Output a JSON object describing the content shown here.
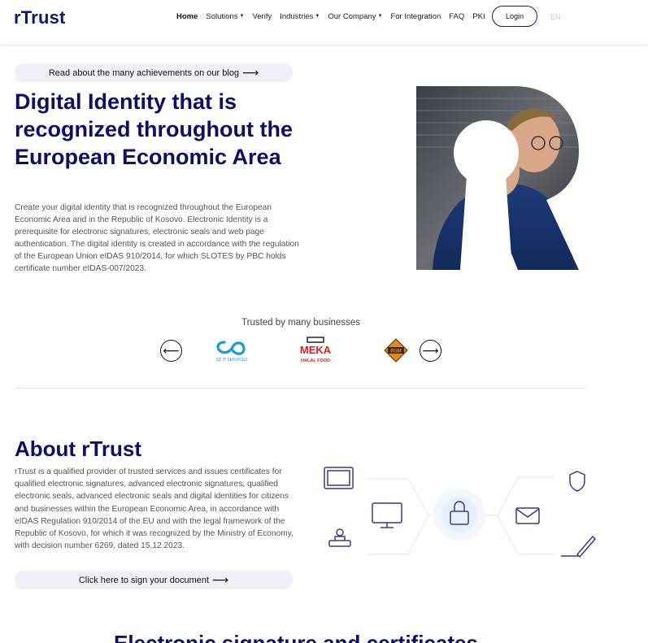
{
  "header": {
    "logo": "rTrust",
    "nav": [
      {
        "label": "Home",
        "active": true,
        "dropdown": false
      },
      {
        "label": "Solutions",
        "active": false,
        "dropdown": true
      },
      {
        "label": "Verify",
        "active": false,
        "dropdown": false
      },
      {
        "label": "Industries",
        "active": false,
        "dropdown": true
      },
      {
        "label": "Our Company",
        "active": false,
        "dropdown": true
      },
      {
        "label": "For Integration",
        "active": false,
        "dropdown": false
      },
      {
        "label": "FAQ",
        "active": false,
        "dropdown": false
      },
      {
        "label": "PKI",
        "active": false,
        "dropdown": false
      }
    ],
    "login_label": "Login",
    "language": "EN"
  },
  "hero": {
    "blog_link": "Read about the many achievements on our blog",
    "title": "Digital Identity that is recognized throughout the European Economic Area",
    "text": "Create your digital identity that is recognized throughout the European Economic Area and in the Republic of Kosovo. Electronic Identity is a prerequisite for electronic signatures, electronic seals and web page authentication. The digital identity is created in accordance with the regulation of the European Union eIDAS 910/2014, for which SLOTES by PBC holds certificate number eIDAS-007/2023."
  },
  "trusted": {
    "label": "Trusted by many businesses",
    "brands": [
      {
        "name": "SD IT SERVICES",
        "color": "#1a9ad6"
      },
      {
        "name": "MEKA",
        "sub": "HALAL FOOD",
        "color": "#d42020"
      },
      {
        "name": "RSM",
        "color": "#e08a1e"
      }
    ]
  },
  "about": {
    "title": "About rTrust",
    "text": "rTrust is a qualified provider of trusted services and issues certificates for qualified electronic signatures, advanced electronic signatures, qualified electronic seals, advanced electronic seals and digital identities for citizens and businesses within the European Economic Area, in accordance with eIDAS Regulation 910/2014 of the EU and with the legal framework of the Republic of Kosovo, for which it was recognized by the Ministry of Economy, with decision number 6269, dated 15.12.2023.",
    "sign_link": "Click here to sign your document"
  },
  "next_section": {
    "title": "Electronic signature and certificates"
  },
  "colors": {
    "brand_navy": "#0d0d6b",
    "pill_bg": "#f0f0fb",
    "icon_stroke": "#3a3a8c"
  }
}
